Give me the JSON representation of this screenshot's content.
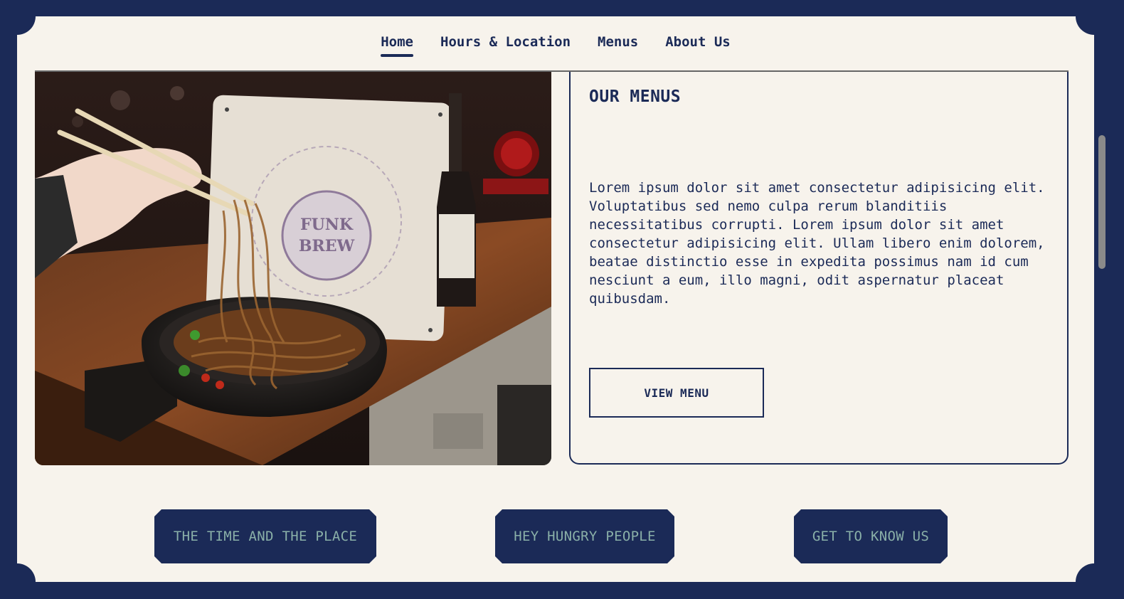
{
  "nav": {
    "items": [
      {
        "label": "Home",
        "active": true
      },
      {
        "label": "Hours & Location",
        "active": false
      },
      {
        "label": "Menus",
        "active": false
      },
      {
        "label": "About Us",
        "active": false
      }
    ]
  },
  "menus_card": {
    "title": "OUR MENUS",
    "body": "Lorem ipsum dolor sit amet consectetur adipisicing elit. Voluptatibus sed nemo culpa rerum blanditiis necessitatibus corrupti. Lorem ipsum dolor sit amet consectetur adipisicing elit. Ullam libero enim dolorem, beatae distinctio esse in expedita possimus nam id cum nesciunt a eum, illo magni, odit aspernatur placeat quibusdam.",
    "button_label": "VIEW MENU"
  },
  "photo": {
    "stamp_text": "FUNK BREW"
  },
  "cta_buttons": [
    {
      "label": "THE TIME AND THE PLACE"
    },
    {
      "label": "HEY HUNGRY PEOPLE"
    },
    {
      "label": "GET TO KNOW US"
    }
  ],
  "colors": {
    "navy": "#1b2a57",
    "cream": "#f7f3ec",
    "cta_text": "#8ab0a8"
  }
}
